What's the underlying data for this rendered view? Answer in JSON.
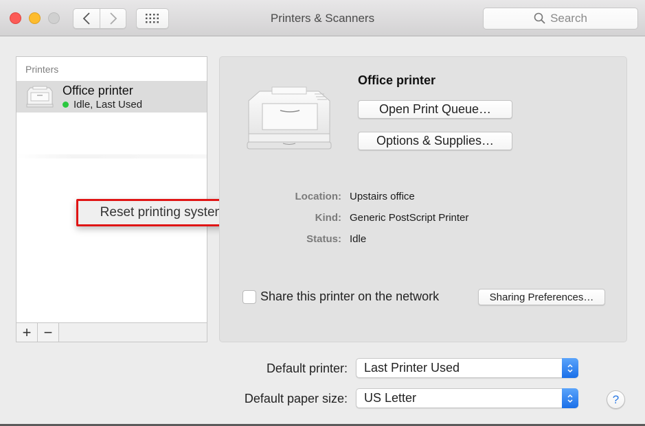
{
  "window": {
    "title": "Printers & Scanners",
    "search_placeholder": "Search"
  },
  "toolbar": {
    "icons": [
      "close-button",
      "minimize-button",
      "zoom-button",
      "back-chevron-icon",
      "forward-chevron-icon",
      "show-all-grid-icon",
      "search-icon"
    ]
  },
  "printer_list": {
    "header": "Printers",
    "items": [
      {
        "name": "Office printer",
        "status": "Idle, Last Used",
        "status_color": "#2bc840"
      }
    ],
    "add_label": "+",
    "remove_label": "−"
  },
  "popup": {
    "label": "Reset printing system…",
    "highlight_color": "#e01515"
  },
  "detail": {
    "printer_name": "Office printer",
    "open_queue_label": "Open Print Queue…",
    "options_label": "Options & Supplies…",
    "info": [
      {
        "label": "Location:",
        "value": "Upstairs office"
      },
      {
        "label": "Kind:",
        "value": "Generic PostScript Printer"
      },
      {
        "label": "Status:",
        "value": "Idle"
      }
    ],
    "share_label": "Share this printer on the network",
    "share_checked": false,
    "sharing_prefs_label": "Sharing Preferences…"
  },
  "settings": {
    "default_printer_label": "Default printer:",
    "default_printer_value": "Last Printer Used",
    "paper_size_label": "Default paper size:",
    "paper_size_value": "US Letter",
    "help_label": "?"
  }
}
